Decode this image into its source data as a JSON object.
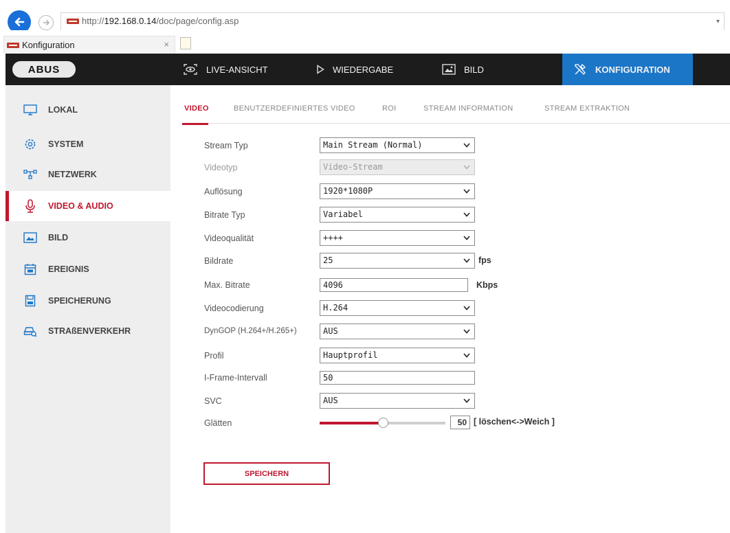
{
  "browser": {
    "url_prefix": "http://",
    "url_host": "192.168.0.14",
    "url_path": "/doc/page/config.asp",
    "tab_title": "Konfiguration",
    "tab_close": "×"
  },
  "header": {
    "logo": "ABUS",
    "nav": [
      {
        "label": "LIVE-ANSICHT"
      },
      {
        "label": "WIEDERGABE"
      },
      {
        "label": "BILD"
      },
      {
        "label": "KONFIGURATION"
      }
    ],
    "accent_color": "#1c76c7"
  },
  "sidebar": {
    "items": [
      {
        "label": "LOKAL"
      },
      {
        "label": "SYSTEM"
      },
      {
        "label": "NETZWERK"
      },
      {
        "label": "VIDEO & AUDIO"
      },
      {
        "label": "BILD"
      },
      {
        "label": "EREIGNIS"
      },
      {
        "label": "SPEICHERUNG"
      },
      {
        "label": "STRAßENVERKEHR"
      }
    ],
    "active_color": "#c0172f"
  },
  "subtabs": [
    {
      "label": "VIDEO"
    },
    {
      "label": "BENUTZERDEFINIERTES VIDEO"
    },
    {
      "label": "ROI"
    },
    {
      "label": "STREAM INFORMATION"
    },
    {
      "label": "STREAM EXTRAKTION"
    }
  ],
  "form": {
    "stream_typ": {
      "label": "Stream Typ",
      "value": "Main Stream (Normal)"
    },
    "videotyp": {
      "label": "Videotyp",
      "value": "Video-Stream"
    },
    "aufloesung": {
      "label": "Auflösung",
      "value": "1920*1080P"
    },
    "bitrate_typ": {
      "label": "Bitrate Typ",
      "value": "Variabel"
    },
    "videoqualitaet": {
      "label": "Videoqualität",
      "value": "++++"
    },
    "bildrate": {
      "label": "Bildrate",
      "value": "25",
      "unit": "fps"
    },
    "max_bitrate": {
      "label": "Max. Bitrate",
      "value": "4096",
      "unit": "Kbps"
    },
    "videocodierung": {
      "label": "Videocodierung",
      "value": "H.264"
    },
    "dyngop": {
      "label": "DynGOP (H.264+/H.265+)",
      "value": "AUS"
    },
    "profil": {
      "label": "Profil",
      "value": "Hauptprofil"
    },
    "iframe": {
      "label": "I-Frame-Intervall",
      "value": "50"
    },
    "svc": {
      "label": "SVC",
      "value": "AUS"
    },
    "glaetten": {
      "label": "Glätten",
      "value": "50",
      "fraction": 0.5,
      "description": "[ löschen<->Weich ]"
    }
  },
  "save_label": "SPEICHERN"
}
